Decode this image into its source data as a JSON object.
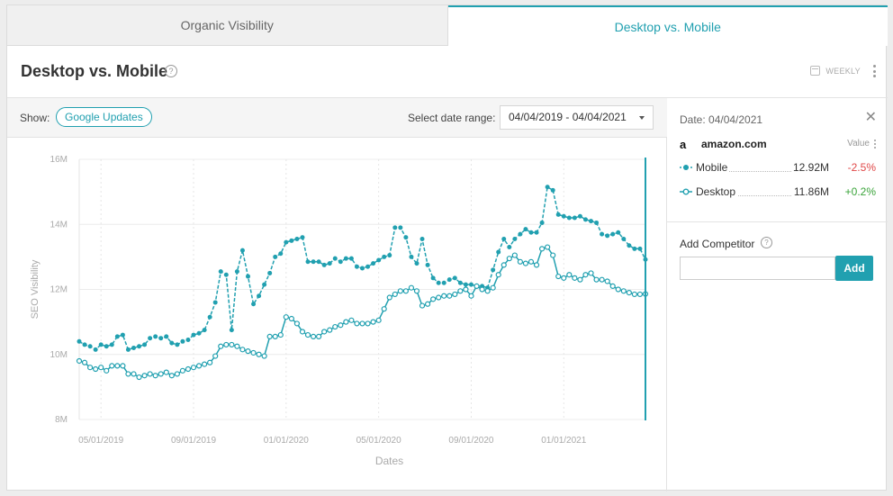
{
  "tabs": [
    {
      "label": "Organic Visibility",
      "active": false
    },
    {
      "label": "Desktop vs. Mobile",
      "active": true
    }
  ],
  "header": {
    "title": "Desktop vs. Mobile",
    "interval": "WEEKLY"
  },
  "filters": {
    "show_label": "Show:",
    "pill_label": "Google Updates",
    "range_label": "Select date range:",
    "range_value": "04/04/2019 - 04/04/2021"
  },
  "sidebar": {
    "date_label": "Date: 04/04/2021",
    "domain": "amazon.com",
    "value_header": "Value",
    "series": [
      {
        "name": "Mobile",
        "value": "12.92M",
        "change": "-2.5%",
        "trend": "neg"
      },
      {
        "name": "Desktop",
        "value": "11.86M",
        "change": "+0.2%",
        "trend": "pos"
      }
    ],
    "competitor_label": "Add Competitor",
    "add_label": "Add"
  },
  "colors": {
    "accent": "#21a0b0",
    "mobile": "#21a0b0",
    "desktop": "#21a0b0",
    "negative": "#e04848",
    "positive": "#3aa43a"
  },
  "chart_data": {
    "type": "line",
    "ylabel": "SEO Visibility",
    "xlabel": "Dates",
    "ylim": [
      8,
      16
    ],
    "yticks": [
      8,
      10,
      12,
      14,
      16
    ],
    "ytick_labels": [
      "8M",
      "10M",
      "12M",
      "14M",
      "16M"
    ],
    "xlim": [
      0,
      104
    ],
    "xticks": [
      {
        "index": 4,
        "label": "05/01/2019"
      },
      {
        "index": 21,
        "label": "09/01/2019"
      },
      {
        "index": 38,
        "label": "01/01/2020"
      },
      {
        "index": 55,
        "label": "05/01/2020"
      },
      {
        "index": 72,
        "label": "09/01/2020"
      },
      {
        "index": 89,
        "label": "01/01/2021"
      }
    ],
    "grid": true,
    "marker_line_index": 104,
    "series": [
      {
        "name": "Mobile",
        "style": "filled",
        "values": [
          10.4,
          10.3,
          10.25,
          10.15,
          10.3,
          10.25,
          10.3,
          10.55,
          10.6,
          10.15,
          10.2,
          10.25,
          10.3,
          10.5,
          10.55,
          10.5,
          10.55,
          10.35,
          10.3,
          10.4,
          10.45,
          10.6,
          10.65,
          10.75,
          11.15,
          11.6,
          12.55,
          12.45,
          10.75,
          12.55,
          13.2,
          12.4,
          11.55,
          11.8,
          12.15,
          12.5,
          13.0,
          13.1,
          13.45,
          13.5,
          13.55,
          13.6,
          12.85,
          12.85,
          12.85,
          12.75,
          12.8,
          12.95,
          12.85,
          12.95,
          12.95,
          12.7,
          12.65,
          12.7,
          12.8,
          12.9,
          13.0,
          13.05,
          13.9,
          13.9,
          13.6,
          13.0,
          12.8,
          13.55,
          12.75,
          12.35,
          12.2,
          12.2,
          12.3,
          12.35,
          12.2,
          12.15,
          12.15,
          12.1,
          12.1,
          12.05,
          12.6,
          13.15,
          13.55,
          13.3,
          13.55,
          13.7,
          13.85,
          13.75,
          13.75,
          14.05,
          15.15,
          15.05,
          14.3,
          14.25,
          14.2,
          14.2,
          14.25,
          14.15,
          14.1,
          14.05,
          13.7,
          13.65,
          13.7,
          13.75,
          13.55,
          13.35,
          13.25,
          13.25,
          12.92
        ]
      },
      {
        "name": "Desktop",
        "style": "hollow",
        "values": [
          9.8,
          9.75,
          9.6,
          9.55,
          9.6,
          9.5,
          9.65,
          9.65,
          9.65,
          9.4,
          9.4,
          9.3,
          9.35,
          9.4,
          9.35,
          9.4,
          9.45,
          9.35,
          9.4,
          9.5,
          9.55,
          9.6,
          9.65,
          9.7,
          9.75,
          9.95,
          10.25,
          10.3,
          10.3,
          10.25,
          10.15,
          10.1,
          10.05,
          10.0,
          9.95,
          10.55,
          10.55,
          10.6,
          11.15,
          11.1,
          10.95,
          10.7,
          10.6,
          10.55,
          10.55,
          10.7,
          10.75,
          10.85,
          10.9,
          11.0,
          11.05,
          10.95,
          10.95,
          10.95,
          11.0,
          11.05,
          11.4,
          11.75,
          11.85,
          11.95,
          11.95,
          12.05,
          11.95,
          11.5,
          11.55,
          11.7,
          11.75,
          11.8,
          11.8,
          11.85,
          11.95,
          12.0,
          11.8,
          12.1,
          12.0,
          11.95,
          12.05,
          12.45,
          12.75,
          12.95,
          13.05,
          12.85,
          12.8,
          12.85,
          12.75,
          13.25,
          13.3,
          13.05,
          12.4,
          12.35,
          12.45,
          12.35,
          12.3,
          12.45,
          12.5,
          12.3,
          12.3,
          12.25,
          12.1,
          12.0,
          11.95,
          11.9,
          11.85,
          11.85,
          11.86
        ]
      }
    ]
  }
}
